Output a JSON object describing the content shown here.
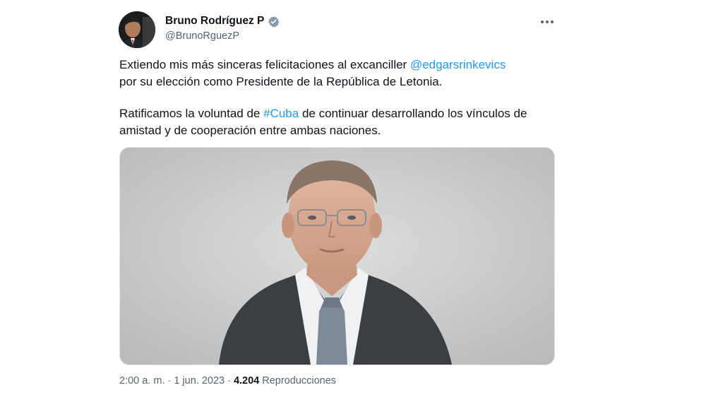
{
  "author": {
    "display_name": "Bruno Rodríguez P",
    "handle": "@BrunoRguezP"
  },
  "tweet": {
    "paragraph1": {
      "text_before": "Extiendo mis más sinceras felicitaciones al excanciller ",
      "mention": "@edgarsrinkevics",
      "text_after": "por su elección como Presidente de la República de Letonia."
    },
    "paragraph2": {
      "text_before": "Ratificamos la voluntad de ",
      "hashtag": "#Cuba",
      "text_after": " de continuar desarrollando los vínculos de amistad y de cooperación entre ambas naciones."
    }
  },
  "meta": {
    "time": "2:00 a. m.",
    "sep1": "·",
    "date": "1 jun. 2023",
    "sep2": "·",
    "views_count": "4.204",
    "views_label": "Reproducciones"
  },
  "colors": {
    "link": "#1d9bf0",
    "verified": "#829aab",
    "secondary_text": "#536471"
  },
  "icons": {
    "verified": "verified-badge-icon",
    "more": "more-options-icon"
  }
}
